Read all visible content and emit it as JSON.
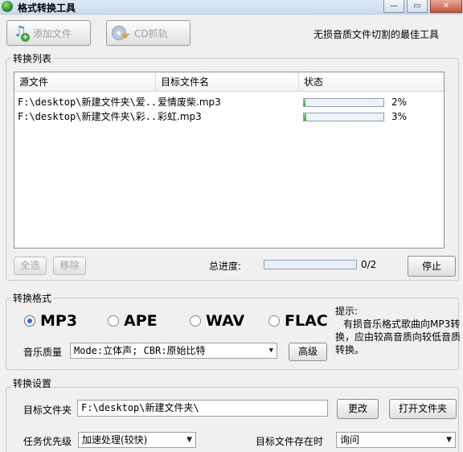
{
  "window": {
    "title": "格式转换工具",
    "minimize_glyph": "—",
    "maximize_glyph": "▭",
    "close_glyph": "✕"
  },
  "toolbar": {
    "add_file_label": "添加文件",
    "cd_rip_label": "CD抓轨",
    "slogan": "无损音质文件切割的最佳工具"
  },
  "convert_list": {
    "group_title": "转换列表",
    "columns": [
      "源文件",
      "目标文件名",
      "状态"
    ],
    "rows": [
      {
        "source": "F:\\desktop\\新建文件夹\\爱...",
        "target": "爱情废柴.mp3",
        "progress": 0.02,
        "status": "2%"
      },
      {
        "source": "F:\\desktop\\新建文件夹\\彩...",
        "target": "彩虹.mp3",
        "progress": 0.03,
        "status": "3%"
      }
    ],
    "select_all_label": "全选",
    "remove_label": "移除",
    "total_progress_label": "总进度:",
    "total_progress_value": 0,
    "total_progress_text": "0/2",
    "stop_label": "停止"
  },
  "format": {
    "group_title": "转换格式",
    "options": [
      {
        "label": "MP3",
        "checked": true
      },
      {
        "label": "APE",
        "checked": false
      },
      {
        "label": "WAV",
        "checked": false
      },
      {
        "label": "FLAC",
        "checked": false
      }
    ],
    "quality_label": "音乐质量",
    "quality_value": "Mode:立体声; CBR:原始比特",
    "advanced_label": "高级",
    "hint_title": "提示:",
    "hint_text": "有损音乐格式歌曲向MP3转换，应由较高音质向较低音质转换。"
  },
  "settings": {
    "group_title": "转换设置",
    "target_folder_label": "目标文件夹",
    "target_folder_value": "F:\\desktop\\新建文件夹\\",
    "change_label": "更改",
    "open_folder_label": "打开文件夹",
    "priority_label": "任务优先级",
    "priority_value": "加速处理(较快)",
    "exists_label": "目标文件存在时",
    "exists_value": "询问"
  },
  "colors": {
    "progress_fill": "#3ea52a",
    "radio_accent": "#2a73c8"
  }
}
